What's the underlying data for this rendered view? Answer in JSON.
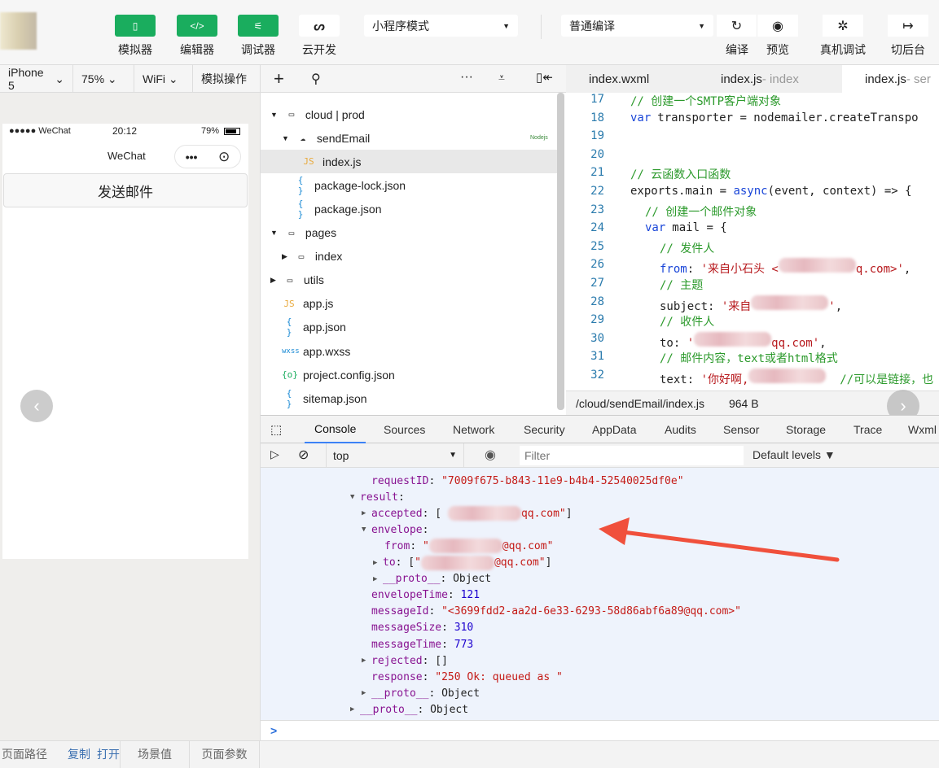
{
  "toolbar": {
    "simulator": "模拟器",
    "editor": "编辑器",
    "debugger": "调试器",
    "cloud": "云开发",
    "mode_select": "小程序模式",
    "compile_select": "普通编译",
    "compile": "编译",
    "preview": "预览",
    "remote_debug": "真机调试",
    "background": "切后台",
    "accent": "#1aad5e"
  },
  "sim_bar": {
    "device": "iPhone 5",
    "zoom": "75%",
    "network": "WiFi",
    "ops": "模拟操作"
  },
  "phone": {
    "carrier": "●●●●● WeChat",
    "time": "20:12",
    "battery": "79%",
    "title": "WeChat",
    "button": "发送邮件"
  },
  "tree": [
    {
      "label": "cloud | prod",
      "icon": "folder-icon",
      "arrow": "▼"
    },
    {
      "label": "sendEmail",
      "icon": "cloud-folder-icon",
      "arrow": "▼",
      "badge": "Nodejs"
    },
    {
      "label": "index.js",
      "icon": "js-icon",
      "glyph": "JS"
    },
    {
      "label": "package-lock.json",
      "icon": "json-icon",
      "glyph": "{ }"
    },
    {
      "label": "package.json",
      "icon": "json-icon",
      "glyph": "{ }"
    },
    {
      "label": "pages",
      "icon": "folder-open-icon",
      "arrow": "▼"
    },
    {
      "label": "index",
      "icon": "folder-icon",
      "arrow": "▶"
    },
    {
      "label": "utils",
      "icon": "folder-icon",
      "arrow": "▶"
    },
    {
      "label": "app.js",
      "icon": "js-icon",
      "glyph": "JS"
    },
    {
      "label": "app.json",
      "icon": "json-icon",
      "glyph": "{ }"
    },
    {
      "label": "app.wxss",
      "icon": "wxss-icon",
      "glyph": "wxss"
    },
    {
      "label": "project.config.json",
      "icon": "config-icon",
      "glyph": "{o}"
    },
    {
      "label": "sitemap.json",
      "icon": "json-icon",
      "glyph": "{ }"
    }
  ],
  "editor_tabs": [
    {
      "name": "index.wxml",
      "suffix": ""
    },
    {
      "name": "index.js",
      "suffix": " - index"
    },
    {
      "name": "index.js",
      "suffix": " - ser"
    }
  ],
  "code": [
    {
      "n": "17",
      "indent": 0,
      "tokens": [
        [
          "cm",
          "// 创建一个SMTP客户端对象"
        ]
      ]
    },
    {
      "n": "18",
      "indent": 0,
      "tokens": [
        [
          "kw",
          "var"
        ],
        [
          "",
          "transporter = nodemailer.createTranspo"
        ]
      ]
    },
    {
      "n": "19",
      "indent": 0,
      "tokens": []
    },
    {
      "n": "20",
      "indent": 0,
      "tokens": []
    },
    {
      "n": "21",
      "indent": 0,
      "tokens": [
        [
          "cm",
          "// 云函数入口函数"
        ]
      ]
    },
    {
      "n": "22",
      "indent": 0,
      "tokens": [
        [
          "",
          "exports.main = "
        ],
        [
          "kw",
          "async"
        ],
        [
          "",
          "(event, context) => {"
        ]
      ]
    },
    {
      "n": "23",
      "indent": 1,
      "tokens": [
        [
          "cm",
          "// 创建一个邮件对象"
        ]
      ]
    },
    {
      "n": "24",
      "indent": 1,
      "tokens": [
        [
          "kw",
          "var"
        ],
        [
          "",
          "mail = {"
        ]
      ]
    },
    {
      "n": "25",
      "indent": 2,
      "tokens": [
        [
          "cm",
          "// 发件人"
        ]
      ]
    },
    {
      "n": "26",
      "indent": 2,
      "tokens": [
        [
          "kw",
          "from"
        ],
        [
          "",
          ": "
        ],
        [
          "st",
          "'来自小石头 <"
        ],
        [
          "blur",
          ""
        ],
        [
          "st",
          "q.com>'"
        ],
        [
          "",
          ","
        ]
      ]
    },
    {
      "n": "27",
      "indent": 2,
      "tokens": [
        [
          "cm",
          "// 主题"
        ]
      ]
    },
    {
      "n": "28",
      "indent": 2,
      "tokens": [
        [
          "",
          "subject: "
        ],
        [
          "st",
          "'来自"
        ],
        [
          "blur",
          ""
        ],
        [
          "st",
          "'"
        ],
        [
          "",
          ","
        ]
      ]
    },
    {
      "n": "29",
      "indent": 2,
      "tokens": [
        [
          "cm",
          "// 收件人"
        ]
      ]
    },
    {
      "n": "30",
      "indent": 2,
      "tokens": [
        [
          "",
          "to: "
        ],
        [
          "st",
          "'"
        ],
        [
          "blur",
          ""
        ],
        [
          "st",
          "qq.com'"
        ],
        [
          "",
          ","
        ]
      ]
    },
    {
      "n": "31",
      "indent": 2,
      "tokens": [
        [
          "cm",
          "// 邮件内容，text或者html格式"
        ]
      ]
    },
    {
      "n": "32",
      "indent": 2,
      "tokens": [
        [
          "",
          "text: "
        ],
        [
          "st",
          "'你好啊,"
        ],
        [
          "blur",
          ""
        ],
        [
          "cm",
          "  //可以是链接，也"
        ]
      ]
    }
  ],
  "editor_status": {
    "path": "/cloud/sendEmail/index.js",
    "size": "964 B"
  },
  "devtools_tabs": [
    "Console",
    "Sources",
    "Network",
    "Security",
    "AppData",
    "Audits",
    "Sensor",
    "Storage",
    "Trace",
    "Wxml"
  ],
  "console_bar": {
    "context": "top",
    "filter_placeholder": "Filter",
    "levels": "Default levels ▼"
  },
  "console": [
    {
      "lvl": 1,
      "tri": "",
      "tokens": [
        [
          "key",
          "requestID"
        ],
        [
          "",
          ": "
        ],
        [
          "sv",
          "\"7009f675-b843-11e9-b4b4-52540025df0e\""
        ]
      ]
    },
    {
      "lvl": 0,
      "tri": "▼",
      "tokens": [
        [
          "key",
          "result"
        ],
        [
          "",
          ":"
        ]
      ]
    },
    {
      "lvl": 1,
      "tri": "▶",
      "tokens": [
        [
          "key",
          "accepted"
        ],
        [
          "",
          ": [ "
        ],
        [
          "blur",
          ""
        ],
        [
          "sv",
          "qq.com\""
        ],
        [
          "",
          "]"
        ]
      ]
    },
    {
      "lvl": 1,
      "tri": "▼",
      "tokens": [
        [
          "key",
          "envelope"
        ],
        [
          "",
          ":"
        ]
      ]
    },
    {
      "lvl": 2,
      "tri": "",
      "tokens": [
        [
          "key",
          "from"
        ],
        [
          "",
          ": "
        ],
        [
          "sv",
          "\""
        ],
        [
          "blur",
          ""
        ],
        [
          "sv",
          "@qq.com\""
        ]
      ]
    },
    {
      "lvl": 2,
      "tri": "▶",
      "tokens": [
        [
          "key",
          "to"
        ],
        [
          "",
          ": ["
        ],
        [
          "sv",
          "\""
        ],
        [
          "blur",
          ""
        ],
        [
          "sv",
          "@qq.com\""
        ],
        [
          "",
          "]"
        ]
      ]
    },
    {
      "lvl": 2,
      "tri": "▶",
      "tokens": [
        [
          "key",
          "__proto__"
        ],
        [
          "",
          ": Object"
        ]
      ]
    },
    {
      "lvl": 1,
      "tri": "",
      "tokens": [
        [
          "key",
          "envelopeTime"
        ],
        [
          "",
          ": "
        ],
        [
          "nv",
          "121"
        ]
      ]
    },
    {
      "lvl": 1,
      "tri": "",
      "tokens": [
        [
          "key",
          "messageId"
        ],
        [
          "",
          ": "
        ],
        [
          "sv",
          "\"<3699fdd2-aa2d-6e33-6293-58d86abf6a89@qq.com>\""
        ]
      ]
    },
    {
      "lvl": 1,
      "tri": "",
      "tokens": [
        [
          "key",
          "messageSize"
        ],
        [
          "",
          ": "
        ],
        [
          "nv",
          "310"
        ]
      ]
    },
    {
      "lvl": 1,
      "tri": "",
      "tokens": [
        [
          "key",
          "messageTime"
        ],
        [
          "",
          ": "
        ],
        [
          "nv",
          "773"
        ]
      ]
    },
    {
      "lvl": 1,
      "tri": "▶",
      "tokens": [
        [
          "key",
          "rejected"
        ],
        [
          "",
          ": []"
        ]
      ]
    },
    {
      "lvl": 1,
      "tri": "",
      "tokens": [
        [
          "key",
          "response"
        ],
        [
          "",
          ": "
        ],
        [
          "sv",
          "\"250 Ok: queued as \""
        ]
      ]
    },
    {
      "lvl": 1,
      "tri": "▶",
      "tokens": [
        [
          "key",
          "__proto__"
        ],
        [
          "",
          ": Object"
        ]
      ]
    },
    {
      "lvl": 0,
      "tri": "▶",
      "tokens": [
        [
          "key",
          "__proto__"
        ],
        [
          "",
          ": Object"
        ]
      ]
    }
  ],
  "console_prompt": ">",
  "bottom": {
    "page_path": "页面路径",
    "copy": "复制",
    "open": "打开",
    "scene": "场景值",
    "params": "页面参数"
  },
  "annotation_color": "#f0503c"
}
